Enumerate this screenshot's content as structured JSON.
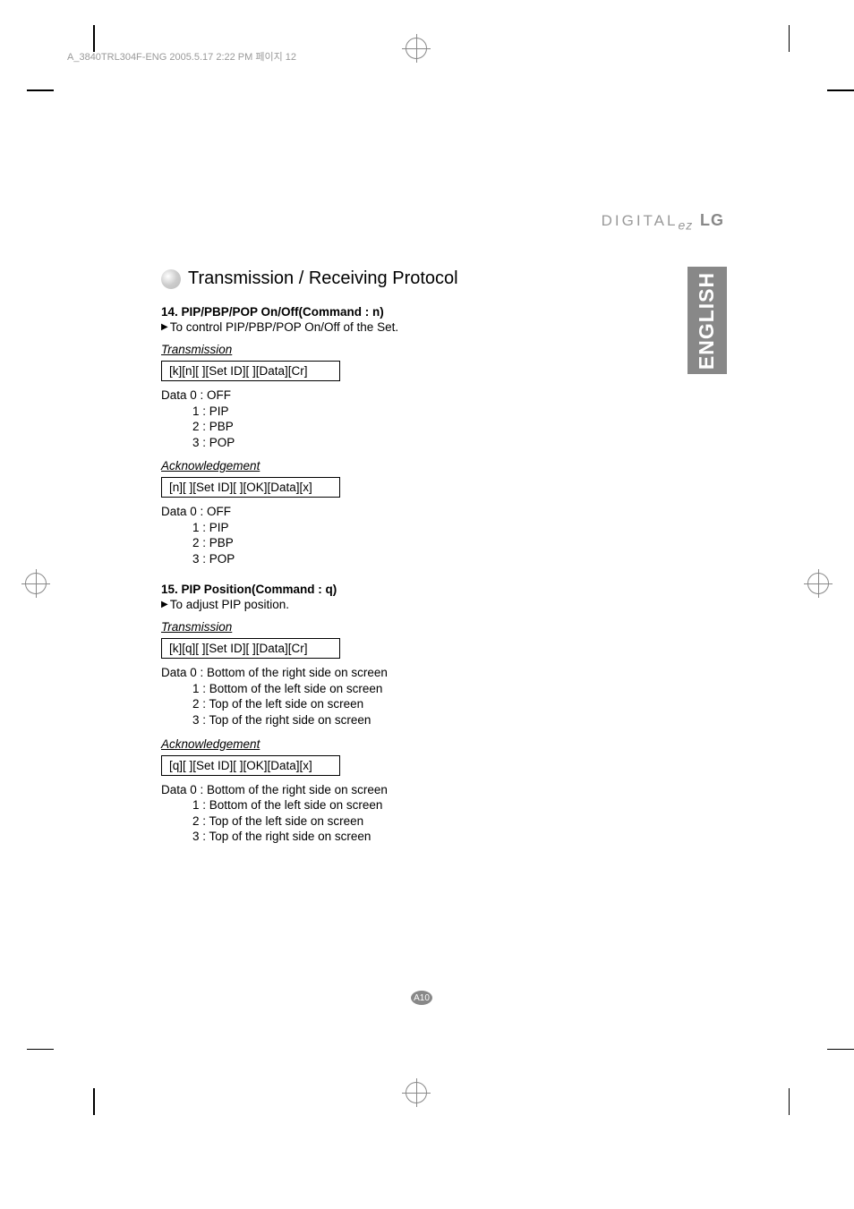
{
  "header_info": "A_3840TRL304F-ENG  2005.5.17  2:22 PM  페이지 12",
  "logo": {
    "digital": "DIGITAL",
    "ez": "ez",
    "lg": "LG"
  },
  "language_tab": "ENGLISH",
  "section_title": "Transmission / Receiving Protocol",
  "item14": {
    "heading": "14. PIP/PBP/POP On/Off(Command : n)",
    "desc": "To control PIP/PBP/POP On/Off of the Set.",
    "transmission_label": "Transmission",
    "transmission_code": "[k][n][ ][Set ID][ ][Data][Cr]",
    "data_block_tx": {
      "line0": "Data 0 : OFF",
      "line1": "1 : PIP",
      "line2": "2 : PBP",
      "line3": "3 : POP"
    },
    "ack_label": "Acknowledgement",
    "ack_code": "[n][ ][Set ID][ ][OK][Data][x]",
    "data_block_ack": {
      "line0": "Data 0 : OFF",
      "line1": "1 : PIP",
      "line2": "2 : PBP",
      "line3": "3 : POP"
    }
  },
  "item15": {
    "heading": "15. PIP Position(Command : q)",
    "desc": " To adjust PIP position.",
    "transmission_label": "Transmission",
    "transmission_code": "[k][q][ ][Set ID][ ][Data][Cr]",
    "data_block_tx": {
      "line0": "Data 0 : Bottom of the right side on screen",
      "line1": "1 : Bottom of the left side on screen",
      "line2": "2 : Top of the left side on screen",
      "line3": "3 : Top of the right side on screen"
    },
    "ack_label": "Acknowledgement",
    "ack_code": "[q][ ][Set ID][ ][OK][Data][x]",
    "data_block_ack": {
      "line0": "Data 0 : Bottom of the right side on screen",
      "line1": "1 : Bottom of the left side on screen",
      "line2": "2 : Top of the left side on screen",
      "line3": "3 : Top of the right side on screen"
    }
  },
  "page_number": "A10"
}
